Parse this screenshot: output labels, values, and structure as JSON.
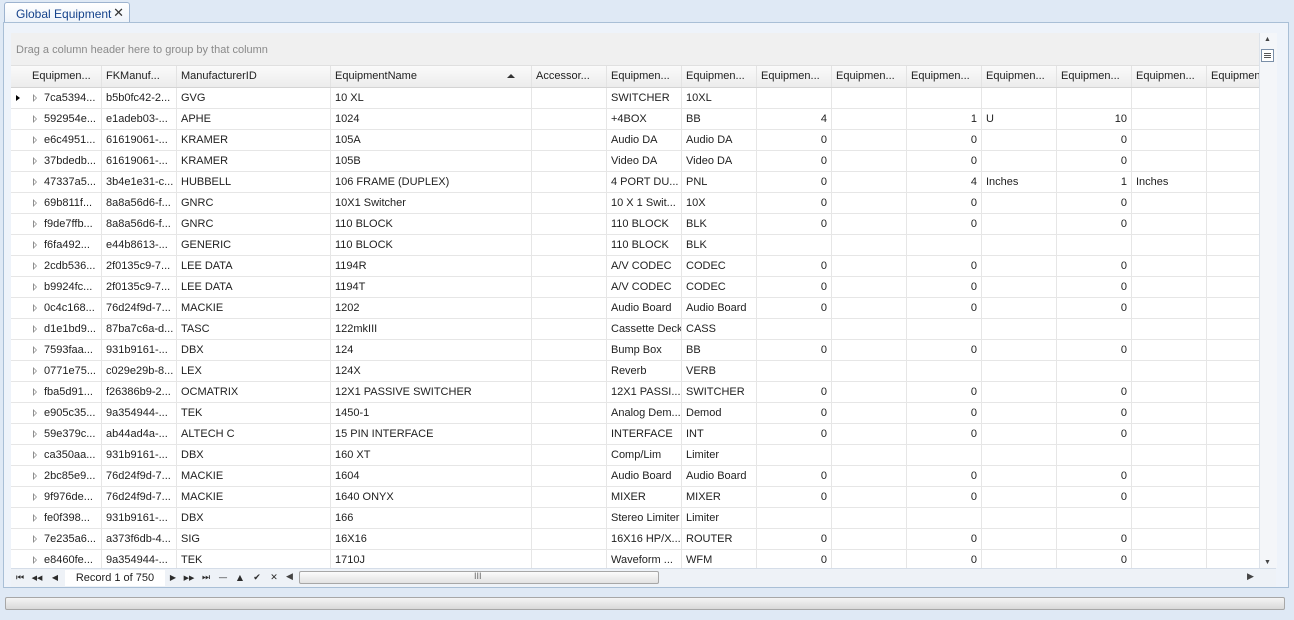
{
  "window": {
    "tab_title": "Global Equipment",
    "close_glyph": "✕"
  },
  "groupbar": {
    "hint": "Drag a column header here to group by that column"
  },
  "grid": {
    "sorted_column": "EquipmentName",
    "sort_direction": "ascending",
    "columns": [
      "Equipmen...",
      "FKManuf...",
      "ManufacturerID",
      "EquipmentName",
      "Accessor...",
      "Equipmen...",
      "Equipmen...",
      "Equipmen...",
      "Equipmen...",
      "Equipmen...",
      "Equipmen...",
      "Equipmen...",
      "Equipmen...",
      "Equipmen..."
    ],
    "rows": [
      [
        "7ca5394...",
        "b5b0fc42-2...",
        "GVG",
        "10 XL",
        "",
        "SWITCHER",
        "10XL",
        "",
        "",
        "",
        "",
        "",
        "",
        ""
      ],
      [
        "592954e...",
        "e1adeb03-...",
        "APHE",
        "1024",
        "",
        "+4BOX",
        "BB",
        "4",
        "",
        "1",
        "U",
        "10",
        "",
        ""
      ],
      [
        "e6c4951...",
        "61619061-...",
        "KRAMER",
        "105A",
        "",
        "Audio DA",
        "Audio DA",
        "0",
        "",
        "0",
        "",
        "0",
        "",
        ""
      ],
      [
        "37bdedb...",
        "61619061-...",
        "KRAMER",
        "105B",
        "",
        "Video DA",
        "Video DA",
        "0",
        "",
        "0",
        "",
        "0",
        "",
        ""
      ],
      [
        "47337a5...",
        "3b4e1e31-c...",
        "HUBBELL",
        "106 FRAME (DUPLEX)",
        "",
        "4 PORT DU...",
        "PNL",
        "0",
        "",
        "4",
        "Inches",
        "1",
        "Inches",
        ""
      ],
      [
        "69b811f...",
        "8a8a56d6-f...",
        "GNRC",
        "10X1 Switcher",
        "",
        "10 X 1 Swit...",
        "10X",
        "0",
        "",
        "0",
        "",
        "0",
        "",
        ""
      ],
      [
        "f9de7ffb...",
        "8a8a56d6-f...",
        "GNRC",
        "110 BLOCK",
        "",
        "110 BLOCK",
        "BLK",
        "0",
        "",
        "0",
        "",
        "0",
        "",
        ""
      ],
      [
        "f6fa492...",
        "e44b8613-...",
        "GENERIC",
        "110 BLOCK",
        "",
        "110 BLOCK",
        "BLK",
        "",
        "",
        "",
        "",
        "",
        "",
        ""
      ],
      [
        "2cdb536...",
        "2f0135c9-7...",
        "LEE DATA",
        "1194R",
        "",
        "A/V CODEC",
        "CODEC",
        "0",
        "",
        "0",
        "",
        "0",
        "",
        ""
      ],
      [
        "b9924fc...",
        "2f0135c9-7...",
        "LEE DATA",
        "1194T",
        "",
        "A/V CODEC",
        "CODEC",
        "0",
        "",
        "0",
        "",
        "0",
        "",
        ""
      ],
      [
        "0c4c168...",
        "76d24f9d-7...",
        "MACKIE",
        "1202",
        "",
        "Audio Board",
        "Audio Board",
        "0",
        "",
        "0",
        "",
        "0",
        "",
        ""
      ],
      [
        "d1e1bd9...",
        "87ba7c6a-d...",
        "TASC",
        "122mkIII",
        "",
        "Cassette Deck",
        "CASS",
        "",
        "",
        "",
        "",
        "",
        "",
        ""
      ],
      [
        "7593faa...",
        "931b9161-...",
        "DBX",
        "124",
        "",
        "Bump Box",
        "BB",
        "0",
        "",
        "0",
        "",
        "0",
        "",
        ""
      ],
      [
        "0771e75...",
        "c029e29b-8...",
        "LEX",
        "124X",
        "",
        "Reverb",
        "VERB",
        "",
        "",
        "",
        "",
        "",
        "",
        ""
      ],
      [
        "fba5d91...",
        "f26386b9-2...",
        "OCMATRIX",
        "12X1 PASSIVE SWITCHER",
        "",
        "12X1 PASSI...",
        "SWITCHER",
        "0",
        "",
        "0",
        "",
        "0",
        "",
        ""
      ],
      [
        "e905c35...",
        "9a354944-...",
        "TEK",
        "1450-1",
        "",
        "Analog Dem...",
        "Demod",
        "0",
        "",
        "0",
        "",
        "0",
        "",
        ""
      ],
      [
        "59e379c...",
        "ab44ad4a-...",
        "ALTECH C",
        "15 PIN INTERFACE",
        "",
        "INTERFACE",
        "INT",
        "0",
        "",
        "0",
        "",
        "0",
        "",
        ""
      ],
      [
        "ca350aa...",
        "931b9161-...",
        "DBX",
        "160 XT",
        "",
        "Comp/Lim",
        "Limiter",
        "",
        "",
        "",
        "",
        "",
        "",
        ""
      ],
      [
        "2bc85e9...",
        "76d24f9d-7...",
        "MACKIE",
        "1604",
        "",
        "Audio Board",
        "Audio Board",
        "0",
        "",
        "0",
        "",
        "0",
        "",
        ""
      ],
      [
        "9f976de...",
        "76d24f9d-7...",
        "MACKIE",
        "1640 ONYX",
        "",
        "MIXER",
        "MIXER",
        "0",
        "",
        "0",
        "",
        "0",
        "",
        ""
      ],
      [
        "fe0f398...",
        "931b9161-...",
        "DBX",
        "166",
        "",
        "Stereo Limiter",
        "Limiter",
        "",
        "",
        "",
        "",
        "",
        "",
        ""
      ],
      [
        "7e235a6...",
        "a373f6db-4...",
        "SIG",
        "16X16",
        "",
        "16X16 HP/X...",
        "ROUTER",
        "0",
        "",
        "0",
        "",
        "0",
        "",
        ""
      ],
      [
        "e8460fe...",
        "9a354944-...",
        "TEK",
        "1710J",
        "",
        "Waveform ...",
        "WFM",
        "0",
        "",
        "0",
        "",
        "0",
        "",
        ""
      ]
    ]
  },
  "navigator": {
    "record_text": "Record 1 of 750",
    "first": "⏮",
    "prev_page": "◀◀",
    "prev": "◀",
    "next": "▶",
    "next_page": "▶▶",
    "last": "⏭",
    "delete": "—",
    "up": "▲",
    "check": "✔",
    "cancel": "✕",
    "scroll_left": "◀",
    "scroll_right": "▶",
    "thumb_grip": "III"
  },
  "vscroll": {
    "up": "▲",
    "down": "▼"
  }
}
